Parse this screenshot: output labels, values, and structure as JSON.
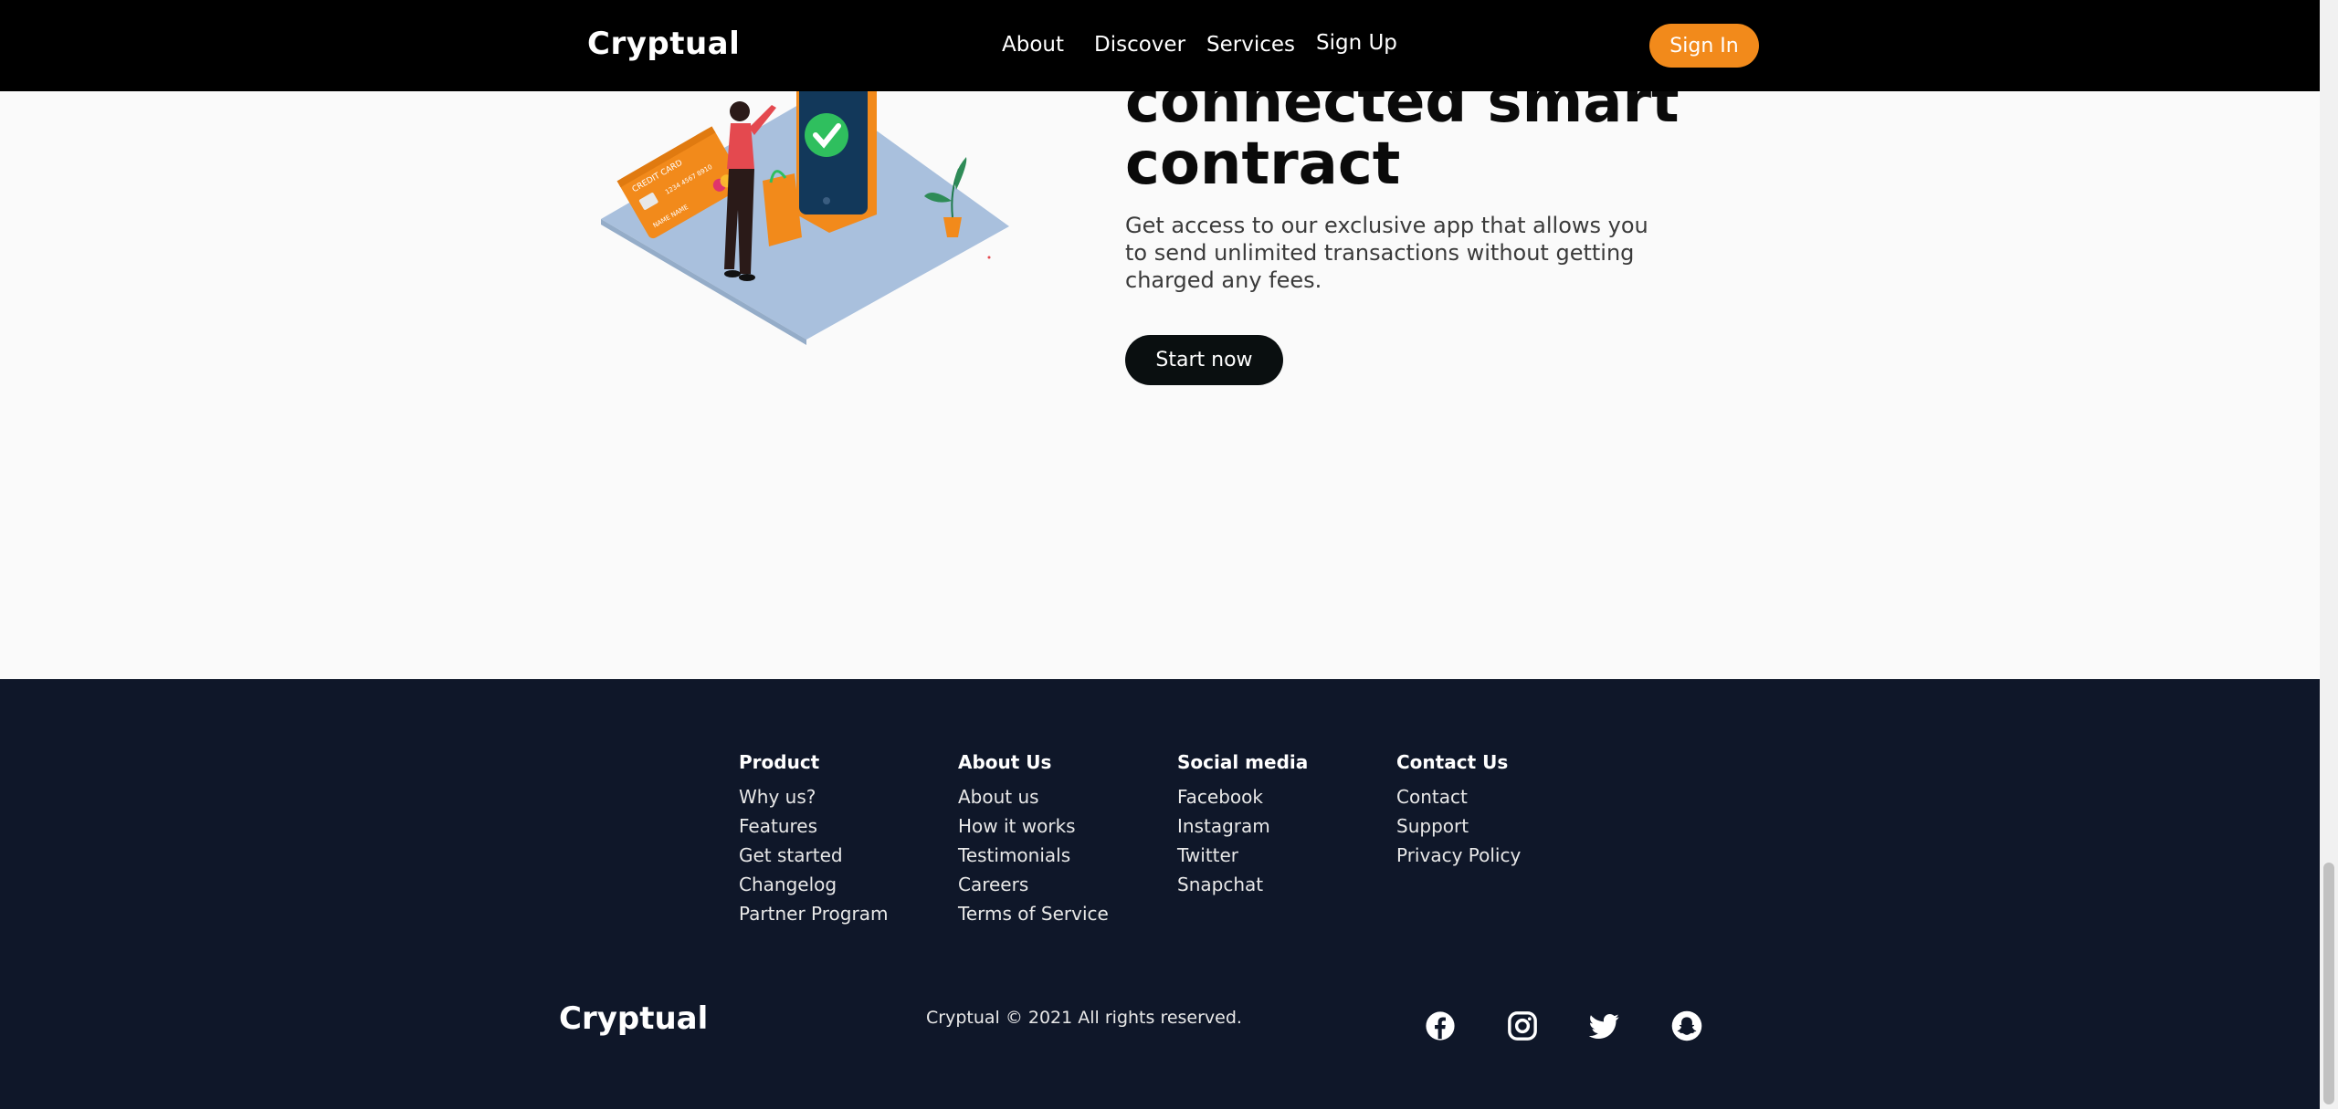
{
  "header": {
    "brand": "Cryptual",
    "nav": [
      "About",
      "Discover",
      "Services",
      "Sign Up"
    ],
    "signin_label": "Sign In",
    "accent": "#f28a1b"
  },
  "hero": {
    "title": "connected smart contract",
    "description": "Get access to our exclusive app that allows you to send unlimited transactions without getting charged any fees.",
    "cta_label": "Start now",
    "illustration": {
      "card_text": "CREDIT CARD",
      "card_number": "1234 4567 8910",
      "card_name": "NAME NAME"
    }
  },
  "footer": {
    "columns": [
      {
        "title": "Product",
        "links": [
          "Why us?",
          "Features",
          "Get started",
          "Changelog",
          "Partner Program"
        ]
      },
      {
        "title": "About Us",
        "links": [
          "About us",
          "How it works",
          "Testimonials",
          "Careers",
          "Terms of Service"
        ]
      },
      {
        "title": "Social media",
        "links": [
          "Facebook",
          "Instagram",
          "Twitter",
          "Snapchat"
        ]
      },
      {
        "title": "Contact Us",
        "links": [
          "Contact",
          "Support",
          "Privacy Policy"
        ]
      }
    ],
    "brand": "Cryptual",
    "copyright": "Cryptual © 2021 All rights reserved.",
    "social_icons": [
      "facebook-icon",
      "instagram-icon",
      "twitter-icon",
      "snapchat-icon"
    ],
    "background": "#0f1729"
  }
}
